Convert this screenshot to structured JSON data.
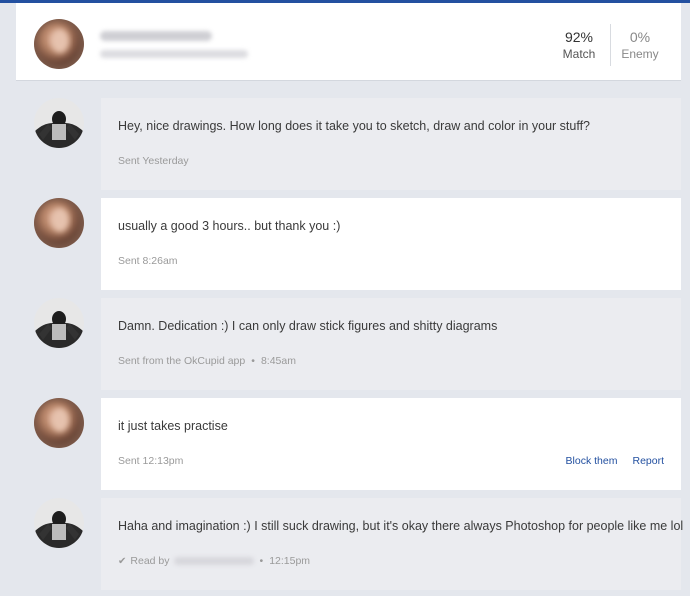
{
  "profile": {
    "match_value": "92%",
    "match_label": "Match",
    "enemy_value": "0%",
    "enemy_label": "Enemy"
  },
  "messages": [
    {
      "sender": "them",
      "text": "Hey, nice drawings. How long does it take you to sketch, draw and color in your stuff?",
      "meta": "Sent Yesterday"
    },
    {
      "sender": "me",
      "text": "usually a good 3 hours.. but thank you :)",
      "meta": "Sent 8:26am"
    },
    {
      "sender": "them",
      "text": "Damn. Dedication :) I can only draw stick figures and shitty diagrams",
      "meta": "Sent from the OkCupid app",
      "time": "8:45am"
    },
    {
      "sender": "me",
      "text": "it just takes practise",
      "meta": "Sent 12:13pm",
      "actions": {
        "block": "Block them",
        "report": "Report"
      }
    },
    {
      "sender": "them",
      "text": "Haha and imagination :) I still suck drawing, but it's okay there always Photoshop for people like me lol",
      "read_label": "Read by",
      "time": "12:15pm"
    }
  ],
  "colors": {
    "accent": "#2350a0",
    "their_bubble": "#ebecf0",
    "my_bubble": "#ffffff",
    "background": "#e4e7ed"
  },
  "icons": {
    "read_receipt": "checkmark-icon",
    "separator": "bullet"
  }
}
